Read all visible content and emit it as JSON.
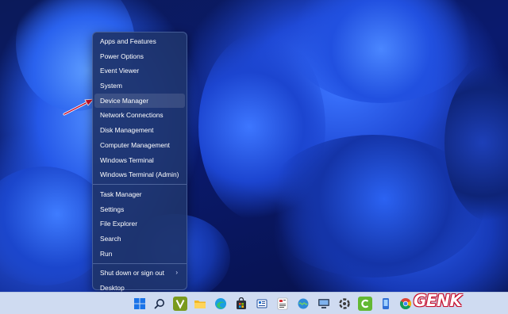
{
  "context_menu": {
    "groups": [
      [
        "Apps and Features",
        "Power Options",
        "Event Viewer",
        "System",
        "Device Manager",
        "Network Connections",
        "Disk Management",
        "Computer Management",
        "Windows Terminal",
        "Windows Terminal (Admin)"
      ],
      [
        "Task Manager",
        "Settings",
        "File Explorer",
        "Search",
        "Run"
      ],
      [
        "Shut down or sign out",
        "Desktop"
      ]
    ],
    "highlighted_item": "Device Manager",
    "submenu_item": "Shut down or sign out",
    "submenu_chevron": "›"
  },
  "annotation": {
    "arrow_color": "#c8102e",
    "points_to": "Device Manager"
  },
  "taskbar": {
    "icons": [
      "windows-start-icon",
      "search-icon",
      "v-app-icon",
      "file-explorer-icon",
      "edge-browser-icon",
      "microsoft-store-icon",
      "app-icon",
      "app-icon",
      "app-icon",
      "app-icon",
      "app-icon",
      "app-icon",
      "app-icon",
      "chrome-icon"
    ]
  },
  "watermark": {
    "text": "GENK"
  },
  "colors": {
    "menu_bg": "#1e346c",
    "taskbar_bg": "#cfdbf1",
    "wallpaper_blue": "#2558e8"
  }
}
